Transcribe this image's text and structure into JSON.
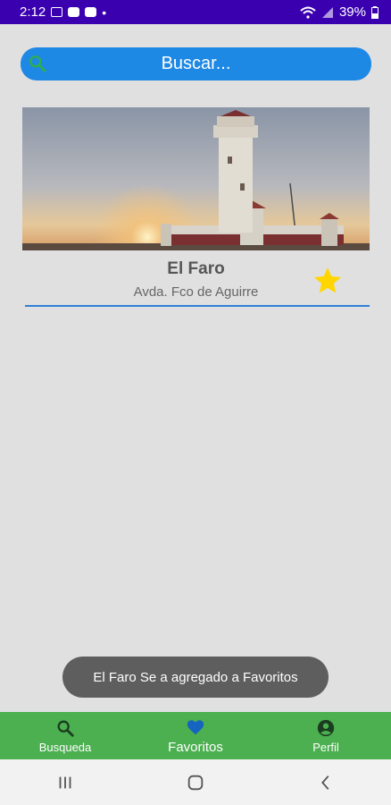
{
  "status_bar": {
    "time": "2:12",
    "battery": "39%"
  },
  "search": {
    "placeholder": "Buscar..."
  },
  "card": {
    "title": "El Faro",
    "address": "Avda. Fco de Aguirre",
    "favorite": true
  },
  "toast": {
    "message": "El Faro Se a agregado a Favoritos"
  },
  "bottom_nav": {
    "items": [
      {
        "label": "Busqueda",
        "icon": "search-icon"
      },
      {
        "label": "Favoritos",
        "icon": "heart-icon",
        "active": true
      },
      {
        "label": "Perfil",
        "icon": "account-icon"
      }
    ]
  },
  "colors": {
    "accent": "#1e88e5",
    "nav_bg": "#4caf50",
    "star": "#ffd600",
    "status_bar": "#3a00b0"
  }
}
